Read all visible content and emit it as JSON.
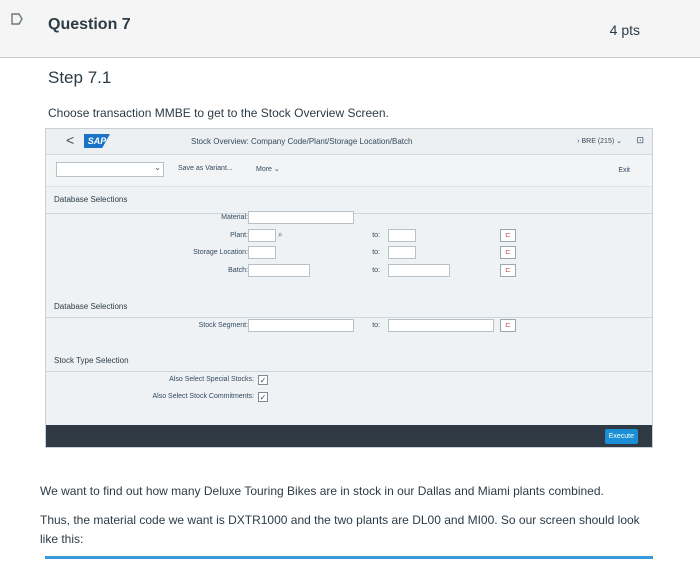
{
  "question": {
    "title": "Question 7",
    "points": "4 pts"
  },
  "step": {
    "title": "Step 7.1",
    "description": "Choose transaction MMBE to get to the Stock Overview Screen."
  },
  "sap": {
    "back": "<",
    "logo": "SAP",
    "title": "Stock Overview: Company Code/Plant/Storage Location/Batch",
    "system": "BRE (215)",
    "toolbar": {
      "save_variant": "Save as Variant...",
      "more": "More",
      "exit": "Exit"
    },
    "sections": {
      "db1": "Database Selections",
      "db2": "Database Selections",
      "stock_type": "Stock Type Selection"
    },
    "fields": {
      "material": "Material:",
      "plant": "Plant:",
      "storage_location": "Storage Location:",
      "batch": "Batch:",
      "stock_segment": "Stock Segment:",
      "to": "to:"
    },
    "checkboxes": {
      "special_stocks": "Also Select Special Stocks:",
      "stock_commitments": "Also Select Stock Commitments:"
    },
    "execute": "Execute"
  },
  "paragraphs": {
    "p1": "We want to find out how many Deluxe Touring Bikes are in stock in our Dallas and Miami plants combined.",
    "p2": "Thus, the material code we want is DXTR1000 and the two plants are DL00 and MI00. So our screen should look like this:"
  },
  "colors": {
    "sap_blue": "#1a73c7",
    "execute_blue": "#1a8fd6",
    "footer": "#2f3a45",
    "accent_bar": "#3a9ad9"
  }
}
